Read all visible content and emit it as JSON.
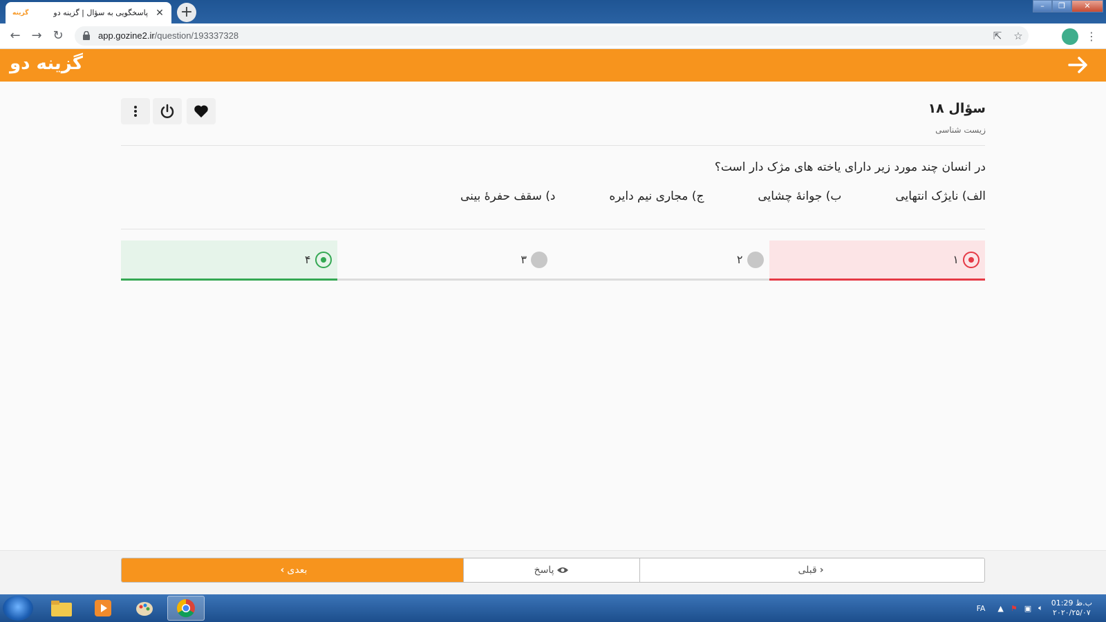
{
  "browser": {
    "tab_title": "پاسخگویی به سؤال | گزینه دو",
    "favicon_text": "گزینه",
    "url_host": "app.gozine2.ir",
    "url_path": "/question/193337328"
  },
  "app": {
    "logo": "گزینه دو",
    "accent_color": "#f7941d"
  },
  "question": {
    "title": "سؤال ۱۸",
    "subject": "زیست شناسی",
    "text": "در انسان چند مورد زیر دارای یاخته های مژک دار است؟",
    "statements": [
      "الف) نایژک انتهایی",
      "ب) جوانهٔ چشایی",
      "ج) مجاری نیم دایره",
      "د) سقف حفرهٔ بینی"
    ]
  },
  "options": [
    {
      "label": "۱",
      "state": "wrong"
    },
    {
      "label": "۲",
      "state": "none"
    },
    {
      "label": "۳",
      "state": "none"
    },
    {
      "label": "۴",
      "state": "correct"
    }
  ],
  "footer": {
    "prev_label": "قبلی",
    "answer_label": "پاسخ",
    "next_label": "بعدی"
  },
  "taskbar": {
    "lang": "FA",
    "time": "ب.ظ 01:29",
    "date": "۲۰۲۰/۲۵/۰۷"
  }
}
